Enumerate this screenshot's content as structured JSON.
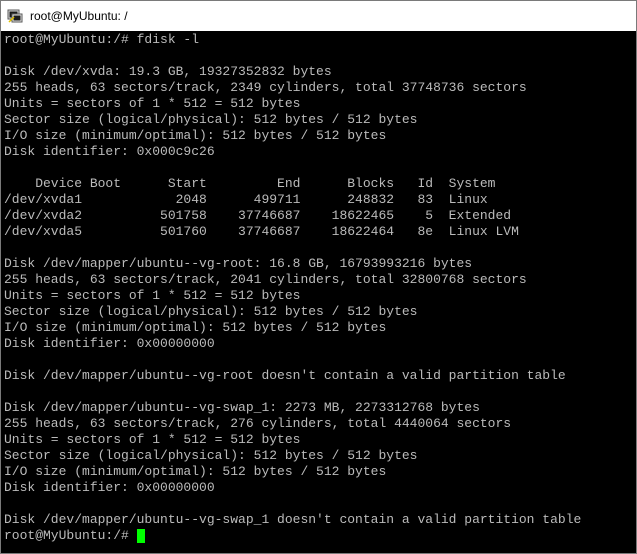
{
  "window": {
    "title": "root@MyUbuntu: /"
  },
  "terminal": {
    "lines": [
      "root@MyUbuntu:/# fdisk -l",
      "",
      "Disk /dev/xvda: 19.3 GB, 19327352832 bytes",
      "255 heads, 63 sectors/track, 2349 cylinders, total 37748736 sectors",
      "Units = sectors of 1 * 512 = 512 bytes",
      "Sector size (logical/physical): 512 bytes / 512 bytes",
      "I/O size (minimum/optimal): 512 bytes / 512 bytes",
      "Disk identifier: 0x000c9c26",
      "",
      "    Device Boot      Start         End      Blocks   Id  System",
      "/dev/xvda1            2048      499711      248832   83  Linux",
      "/dev/xvda2          501758    37746687    18622465    5  Extended",
      "/dev/xvda5          501760    37746687    18622464   8e  Linux LVM",
      "",
      "Disk /dev/mapper/ubuntu--vg-root: 16.8 GB, 16793993216 bytes",
      "255 heads, 63 sectors/track, 2041 cylinders, total 32800768 sectors",
      "Units = sectors of 1 * 512 = 512 bytes",
      "Sector size (logical/physical): 512 bytes / 512 bytes",
      "I/O size (minimum/optimal): 512 bytes / 512 bytes",
      "Disk identifier: 0x00000000",
      "",
      "Disk /dev/mapper/ubuntu--vg-root doesn't contain a valid partition table",
      "",
      "Disk /dev/mapper/ubuntu--vg-swap_1: 2273 MB, 2273312768 bytes",
      "255 heads, 63 sectors/track, 276 cylinders, total 4440064 sectors",
      "Units = sectors of 1 * 512 = 512 bytes",
      "Sector size (logical/physical): 512 bytes / 512 bytes",
      "I/O size (minimum/optimal): 512 bytes / 512 bytes",
      "Disk identifier: 0x00000000",
      "",
      "Disk /dev/mapper/ubuntu--vg-swap_1 doesn't contain a valid partition table"
    ],
    "prompt": "root@MyUbuntu:/# ",
    "cursor_color": "#00ff00",
    "text_color": "#bbbbbb",
    "background_color": "#000000"
  }
}
